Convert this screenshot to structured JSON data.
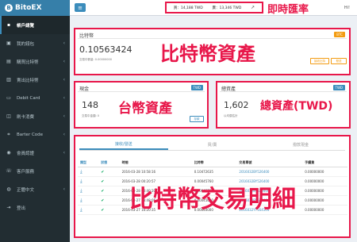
{
  "brand": {
    "name": "BitoEX",
    "logo_letter": "B"
  },
  "sidebar": {
    "items": [
      {
        "label": "帳戶總覽",
        "icon": "dashboard-icon",
        "glyph": "▪",
        "active": true,
        "chevron": ""
      },
      {
        "label": "我的錢包",
        "icon": "wallet-icon",
        "glyph": "▣",
        "active": false,
        "chevron": "‹"
      },
      {
        "label": "購買比特幣",
        "icon": "cart-icon",
        "glyph": "▤",
        "active": false,
        "chevron": "‹"
      },
      {
        "label": "賣出比特幣",
        "icon": "sell-icon",
        "glyph": "▥",
        "active": false,
        "chevron": "‹"
      },
      {
        "label": "Debit Card",
        "icon": "card-icon",
        "glyph": "▭",
        "active": false,
        "chevron": "‹"
      },
      {
        "label": "刷卡消費",
        "icon": "pay-icon",
        "glyph": "◫",
        "active": false,
        "chevron": "‹"
      },
      {
        "label": "Barter Code",
        "icon": "code-icon",
        "glyph": "⌗",
        "active": false,
        "chevron": "‹"
      },
      {
        "label": "會員認證",
        "icon": "verify-icon",
        "glyph": "◉",
        "active": false,
        "chevron": "‹"
      },
      {
        "label": "客戶服務",
        "icon": "support-icon",
        "glyph": "☏",
        "active": false,
        "chevron": ""
      },
      {
        "label": "正體中文",
        "icon": "language-icon",
        "glyph": "◍",
        "active": false,
        "chevron": "‹"
      },
      {
        "label": "登出",
        "icon": "logout-icon",
        "glyph": "⇥",
        "active": false,
        "chevron": ""
      }
    ]
  },
  "topbar": {
    "menu_glyph": "≡",
    "buy_rate": "買：14,188 TWD",
    "sell_rate": "賣：13,346 TWD",
    "trend_glyph": "↗",
    "rate_annotation": "即時匯率",
    "user": "Hi!"
  },
  "btc_card": {
    "title": "比特幣",
    "badge": "BTC",
    "value": "0.10563424",
    "note": "交易中數量: 0.00000000",
    "annotation": "比特幣資產",
    "btn_receive": "接收比特",
    "btn_send": "發送"
  },
  "cash_card": {
    "title": "現金",
    "badge": "TWD",
    "value": "148",
    "note": "交易中金額: 0",
    "annotation": "台幣資產",
    "btn_deposit": "存款"
  },
  "total_card": {
    "title": "總資產",
    "badge": "TWD",
    "value": "1,602",
    "note": "以均價估計",
    "annotation": "總資產(TWD)"
  },
  "transactions": {
    "annotation": "比特幣交易明細",
    "tabs": [
      "接收/發送",
      "買/賣",
      "撥款現金"
    ],
    "headers": [
      "類型",
      "狀態",
      "時間",
      "比特幣",
      "交易單號",
      "手續費"
    ],
    "rows": [
      {
        "time": "2016-03-28 10:58:16",
        "btc": "0.10472635",
        "tx": "2016032BY526400",
        "fee": "0.00000000"
      },
      {
        "time": "2016-03-28 00:20:57",
        "btc": "0.00045760",
        "tx": "2016032BY526400",
        "fee": "0.00000000"
      },
      {
        "time": "2016-03-28 00:40:20",
        "btc": "0.00045760",
        "tx": "2016032BY526400",
        "fee": "0.00000000"
      },
      {
        "time": "2016-03-27 18:48:05",
        "btc": "0.00045000",
        "tx": "2016032BY526400",
        "fee": "0.00000000"
      },
      {
        "time": "2016-03-27 16:20:35",
        "btc": "0.00040000",
        "tx": "2016032YY164104",
        "fee": "0.00000000"
      }
    ]
  },
  "colors": {
    "accent": "#3c8dbc",
    "annotation": "#e8174a",
    "sidebar": "#222d32"
  }
}
